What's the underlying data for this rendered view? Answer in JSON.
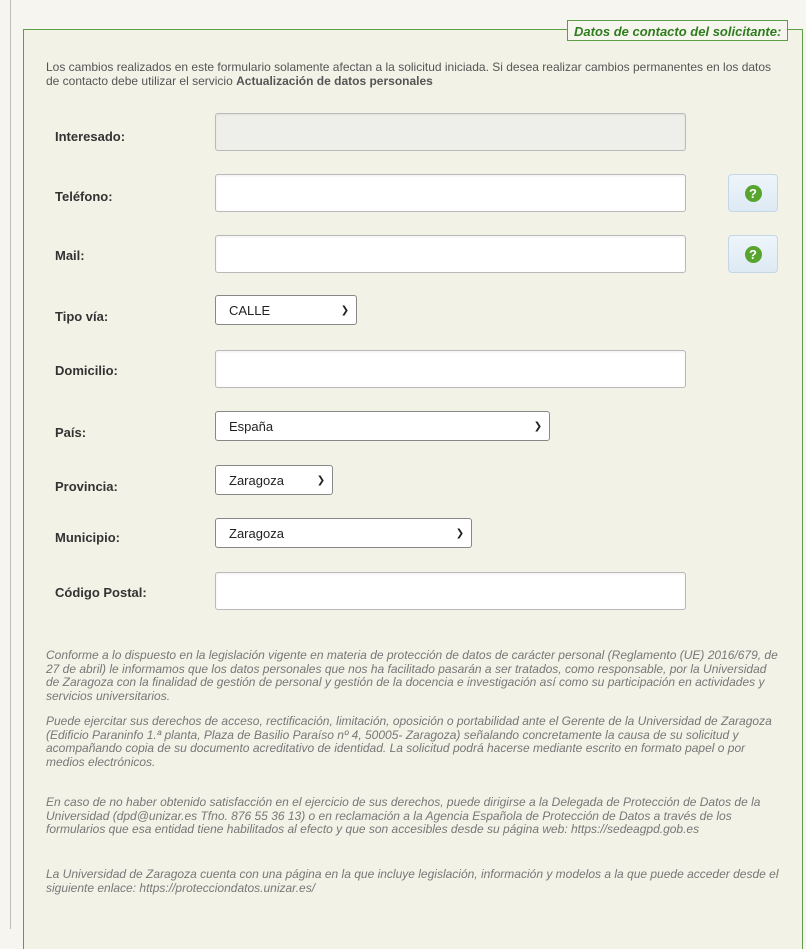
{
  "form": {
    "legend": "Datos de contacto del solicitante:",
    "intro_text": "Los cambios realizados en este formulario solamente afectan a la solicitud iniciada. Si desea realizar cambios permanentes en los datos de contacto debe utilizar el servicio ",
    "intro_link": "Actualización de datos personales",
    "fields": {
      "interesado": {
        "label": "Interesado:",
        "value": ""
      },
      "telefono": {
        "label": "Teléfono:",
        "value": ""
      },
      "mail": {
        "label": "Mail:",
        "value": ""
      },
      "tipo_via": {
        "label": "Tipo vía:",
        "selected": "CALLE"
      },
      "domicilio": {
        "label": "Domicilio:",
        "value": ""
      },
      "pais": {
        "label": "País:",
        "selected": "España"
      },
      "provincia": {
        "label": "Provincia:",
        "selected": "Zaragoza"
      },
      "municipio": {
        "label": "Municipio:",
        "selected": "Zaragoza"
      },
      "codigo_postal": {
        "label": "Código Postal:",
        "value": ""
      }
    },
    "help_icon": "question-mark-icon",
    "help_icon_color": "#57a42e",
    "accent_color": "#5c9d45"
  },
  "legal": {
    "p1": "Conforme a lo dispuesto en la legislación vigente en materia de protección de datos de carácter personal (Reglamento (UE) 2016/679, de 27 de abril) le informamos que los datos personales que nos ha facilitado pasarán a ser tratados, como responsable, por la Universidad de Zaragoza con la finalidad de gestión de personal y gestión de la docencia e investigación así como su participación en actividades y servicios universitarios.",
    "p2": "Puede ejercitar sus derechos de acceso, rectificación, limitación, oposición o portabilidad ante el Gerente de la Universidad de Zaragoza (Edificio Paraninfo 1.ª planta, Plaza de Basilio Paraíso nº 4, 50005- Zaragoza) señalando concretamente la causa de su solicitud y acompañando copia de su documento acreditativo de identidad. La solicitud podrá hacerse mediante escrito en formato papel o por medios electrónicos.",
    "p3": "En caso de no haber obtenido satisfacción en el ejercicio de sus derechos, puede dirigirse a la Delegada de Protección de Datos de la Universidad (dpd@unizar.es Tfno. 876 55 36 13) o en reclamación a la Agencia Española de Protección de Datos a través de los formularios que esa entidad tiene habilitados al efecto y que son accesibles desde su página web: https://sedeagpd.gob.es",
    "p4": "La Universidad de Zaragoza cuenta con una página en la que incluye legislación, información y modelos a la que puede acceder desde el siguiente enlace: https://protecciondatos.unizar.es/"
  }
}
